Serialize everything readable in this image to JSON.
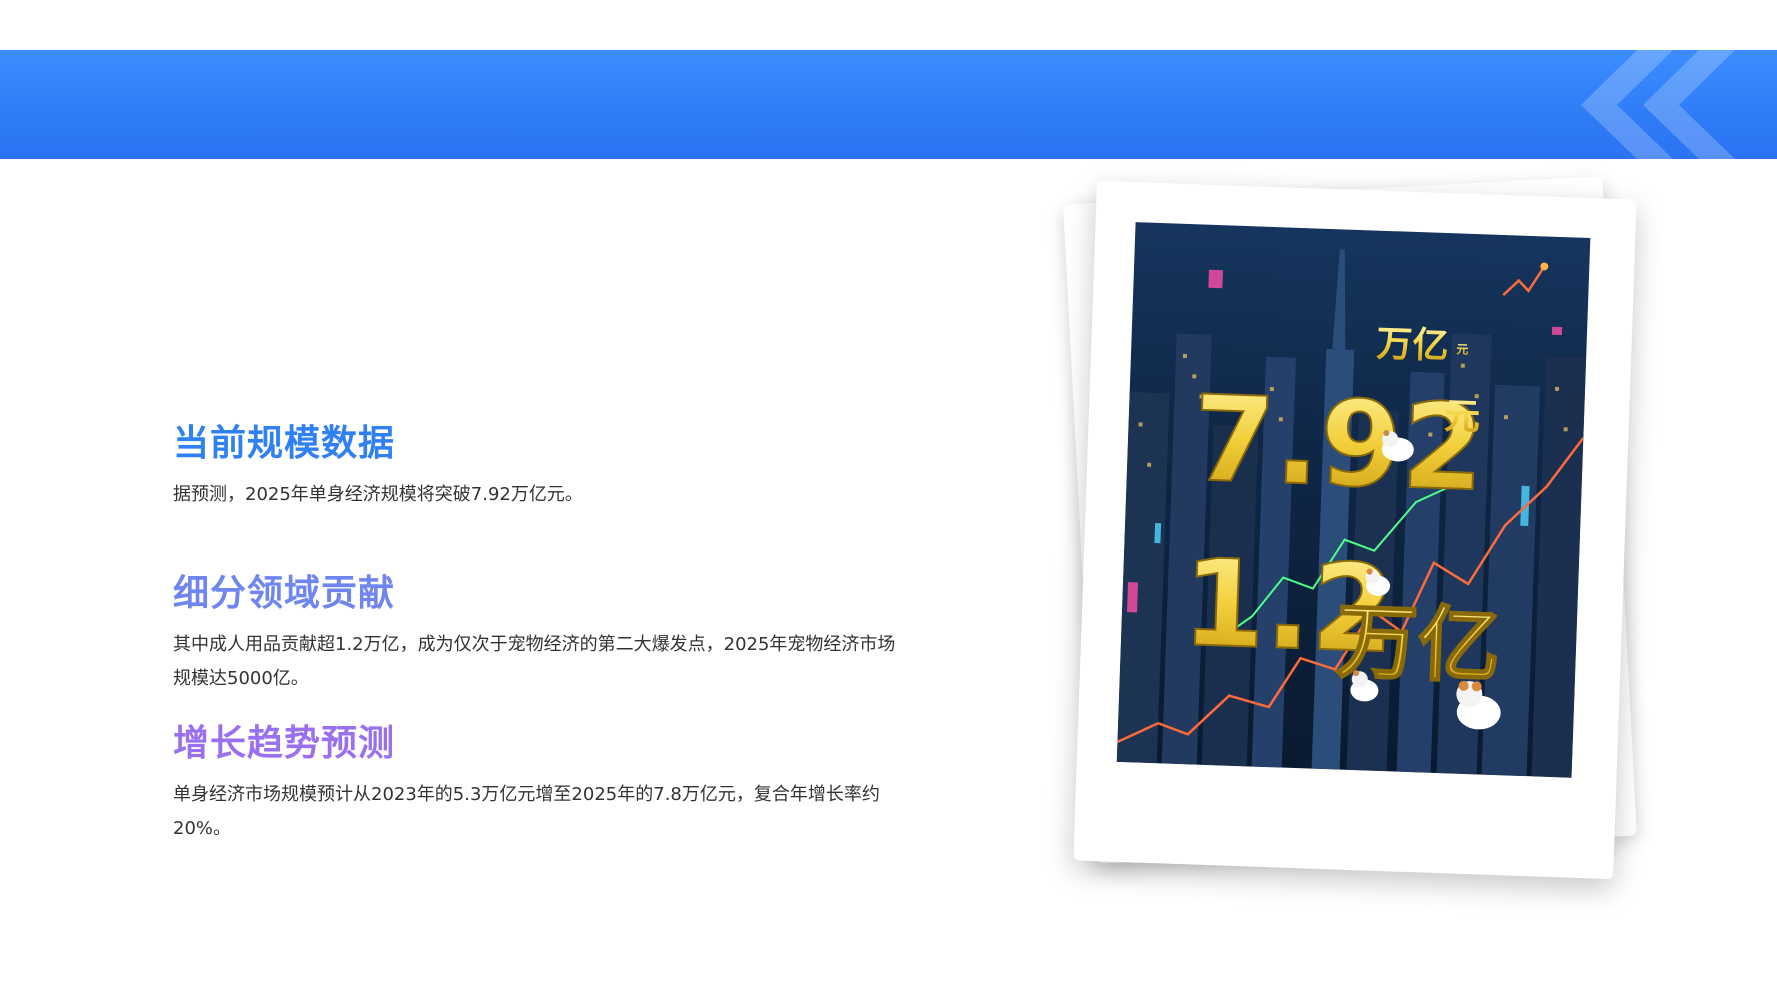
{
  "sections": [
    {
      "title": "当前规模数据",
      "text": "据预测，2025年单身经济规模将突破7.92万亿元。"
    },
    {
      "title": "细分领域贡献",
      "text": "其中成人用品贡献超1.2万亿，成为仅次于宠物经济的第二大爆发点，2025年宠物经济市场规模达5000亿。"
    },
    {
      "title": "增长趋势预测",
      "text": "单身经济市场规模预计从2023年的5.3万亿元增至2025年的7.8万亿元，复合年增长率约20%。"
    }
  ],
  "image": {
    "big_number": "7.92",
    "big_unit": "万亿",
    "big_unit_small": "元",
    "side_unit": "元",
    "second_number": "1.2",
    "second_unit": "万亿"
  },
  "colors": {
    "banner": "#2f7cf7",
    "title1": "#2f7ff5",
    "title2": "#6f86f0",
    "title3": "#9a6ff0"
  }
}
